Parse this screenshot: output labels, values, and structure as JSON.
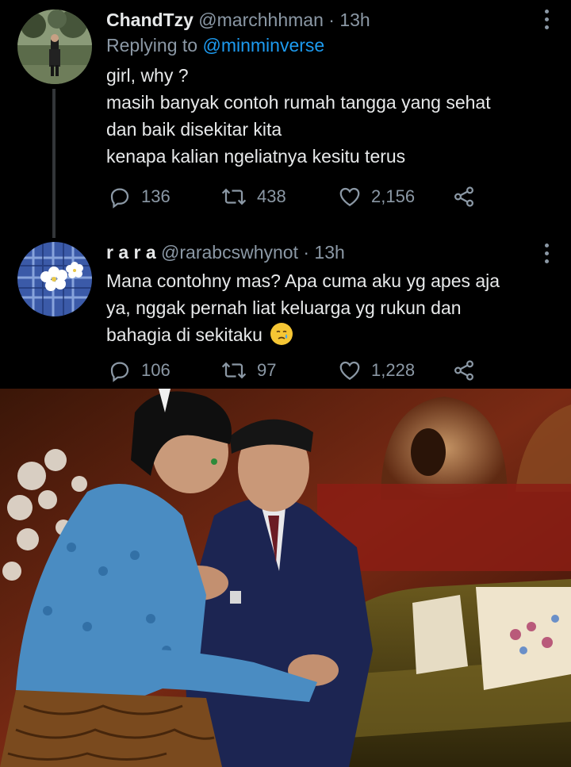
{
  "tweets": [
    {
      "name": "ChandTzy",
      "handle": "@marchhhman",
      "separator": "·",
      "time": "13h",
      "replying_prefix": "Replying to",
      "replying_to": "@minminverse",
      "lines": [
        "girl, why ?",
        "masih banyak contoh rumah tangga yang sehat",
        "dan baik disekitar kita",
        "kenapa kalian ngeliatnya kesitu terus"
      ],
      "replies": "136",
      "retweets": "438",
      "likes": "2,156",
      "avatar_icon": "profile-photo"
    },
    {
      "name": "r a r a",
      "handle": "@rarabcswhynot",
      "separator": "·",
      "time": "13h",
      "lines": [
        "Mana contohny mas? Apa cuma aku yg apes aja",
        "ya, nggak pernah liat keluarga yg rukun dan",
        "bahagia di sekitaku"
      ],
      "replies": "106",
      "retweets": "97",
      "likes": "1,228",
      "avatar_icon": "flower-photo",
      "emoji": "crying-face-emoji"
    }
  ],
  "colors": {
    "background": "#000000",
    "text": "#e7e9ea",
    "secondary": "#8b98a5",
    "link": "#1d9bf0",
    "thread_line": "#333639"
  },
  "icons": [
    "more-icon",
    "reply-icon",
    "retweet-icon",
    "like-icon",
    "share-icon"
  ]
}
